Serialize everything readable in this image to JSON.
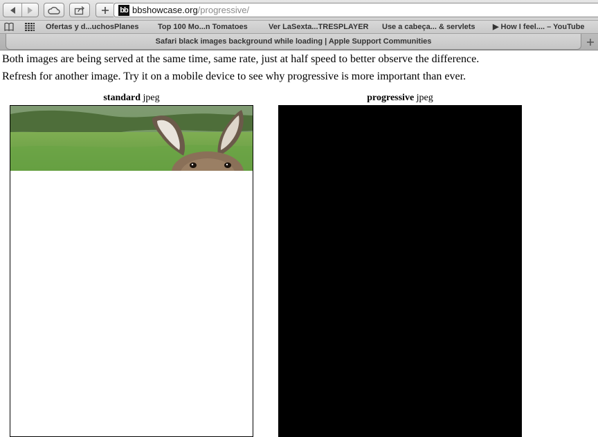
{
  "browser": {
    "url_host": "bbshowcase.org",
    "url_path": "/progressive/",
    "favicon_text": "bb",
    "colors": {
      "toolbar": "#dcdcdc",
      "accent": "#000000"
    }
  },
  "bookmarks": {
    "items": [
      {
        "label": "Ofertas y d...uchosPlanes"
      },
      {
        "label": "Top 100 Mo...n Tomatoes"
      },
      {
        "label": "Ver LaSexta...TRESPLAYER"
      },
      {
        "label": "Use a cabeça... & servlets"
      },
      {
        "label": "▶ How I feel.... – YouTube"
      }
    ]
  },
  "tab": {
    "title": "Safari black images background while loading | Apple Support Communities"
  },
  "page": {
    "line1": "Both images are being served at the same time, same rate, just at half speed to better observe the difference.",
    "line2": "Refresh for another image. Try it on a mobile device to see why progressive is more important than ever.",
    "standard_bold": "standard",
    "standard_rest": " jpeg",
    "progressive_bold": "progressive",
    "progressive_rest": " jpeg"
  }
}
